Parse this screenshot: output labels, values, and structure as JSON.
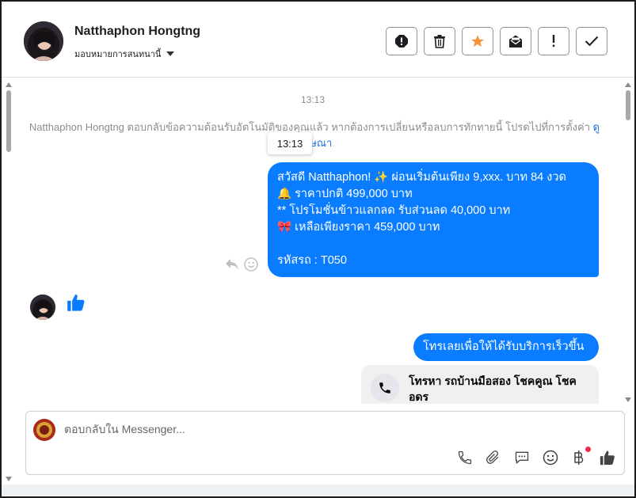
{
  "header": {
    "contact_name": "Natthaphon Hongtng",
    "assign_label": "มอบหมายการสนทนานี้",
    "actions": [
      {
        "icon": "alert-icon"
      },
      {
        "icon": "trash-icon"
      },
      {
        "icon": "star-icon",
        "color": "#f7923b"
      },
      {
        "icon": "mark-unread-icon"
      },
      {
        "icon": "exclamation-icon"
      },
      {
        "icon": "check-icon"
      }
    ]
  },
  "thread": {
    "timestamp": "13:13",
    "system_note_text": "Natthaphon Hongtng ตอบกลับข้อความต้อนรับอัตโนมัติของคุณแล้ว หากต้องการเปลี่ยนหรือลบการทักทายนี้ โปรดไปที่การตั้งค่า",
    "system_note_link": "ดูโฆษณา",
    "tooltip_time": "13:13",
    "main_message": {
      "line1": "สวัสดี Natthaphon! ✨  ผ่อนเริ่มต้นเพียง 9,xxx. บาท 84 งวด",
      "line2": "🔔 ราคาปกติ 499,000 บาท",
      "line3": "** โปรโมชั่นข้าวแลกลด รับส่วนลด 40,000 บาท",
      "line4": "🎀  เหลือเพียงราคา 459,000 บาท",
      "line5": " รหัสรถ : T050"
    },
    "call_prompt": "โทรเลยเพื่อให้ได้รับบริการเร็วขึ้น",
    "call_card_text": "โทรหา รถบ้านมือสอง โชคคูณ โชคอดร"
  },
  "composer": {
    "placeholder": "ตอบกลับใน Messenger...",
    "tools": [
      "phone-icon",
      "attachment-icon",
      "saved-reply-icon",
      "emoji-icon",
      "baht-payment-icon",
      "like-icon"
    ]
  },
  "colors": {
    "accent": "#0a7cff",
    "star": "#f7923b",
    "notification_dot": "#f02849"
  }
}
